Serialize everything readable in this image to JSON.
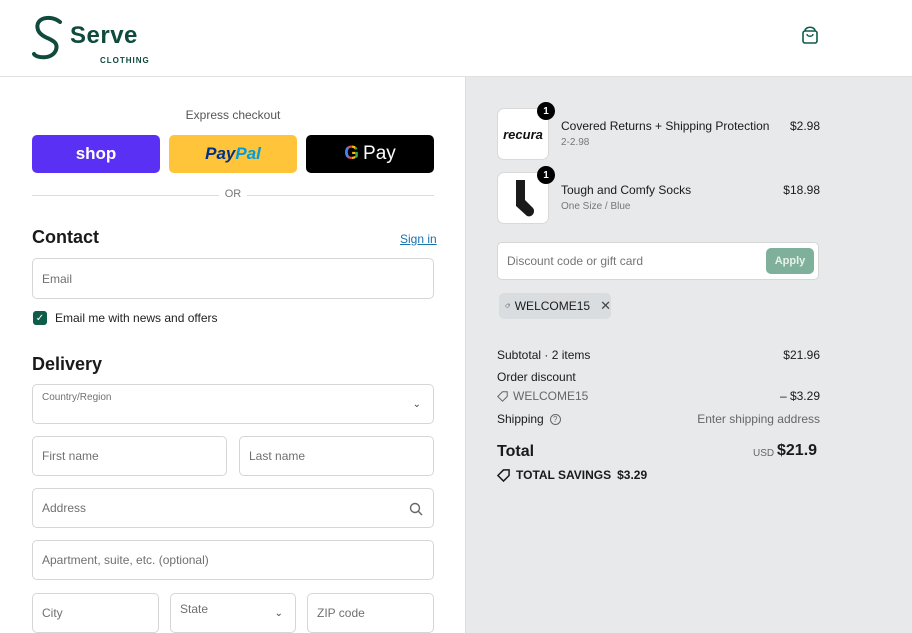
{
  "brand": {
    "name": "Serve",
    "sub": "CLOTHING"
  },
  "express": {
    "label": "Express checkout",
    "shop_label": "shop",
    "paypal_label_a": "Pay",
    "paypal_label_b": "Pal",
    "gpay_g": "G",
    "gpay_label": "Pay",
    "or": "OR"
  },
  "contact": {
    "title": "Contact",
    "signin": "Sign in",
    "email_placeholder": "Email",
    "newsletter_label": "Email me with news and offers",
    "newsletter_checked": true
  },
  "delivery": {
    "title": "Delivery",
    "country_label": "Country/Region",
    "first_name": "First name",
    "last_name": "Last name",
    "address": "Address",
    "apartment": "Apartment, suite, etc. (optional)",
    "city": "City",
    "state": "State",
    "zip": "ZIP code"
  },
  "order": {
    "items": [
      {
        "name": "Covered Returns + Shipping Protection",
        "variant": "2-2.98",
        "price": "$2.98",
        "qty": "1",
        "thumb_text": "recura"
      },
      {
        "name": "Tough and Comfy Socks",
        "variant": "One Size / Blue",
        "price": "$18.98",
        "qty": "1"
      }
    ],
    "discount_placeholder": "Discount code or gift card",
    "apply_label": "Apply",
    "applied_code": "WELCOME15",
    "subtotal_label": "Subtotal · 2 items",
    "subtotal_value": "$21.96",
    "order_discount_label": "Order discount",
    "discount_code": "WELCOME15",
    "discount_value": "– $3.29",
    "shipping_label": "Shipping",
    "shipping_value": "Enter shipping address",
    "total_label": "Total",
    "currency": "USD",
    "total_value": "$21.9",
    "savings_label": "TOTAL SAVINGS",
    "savings_value": "$3.29"
  },
  "colors": {
    "accent": "#0f5c4a",
    "shop": "#5a31f4",
    "paypal": "#ffc439",
    "link": "#1773b0"
  }
}
